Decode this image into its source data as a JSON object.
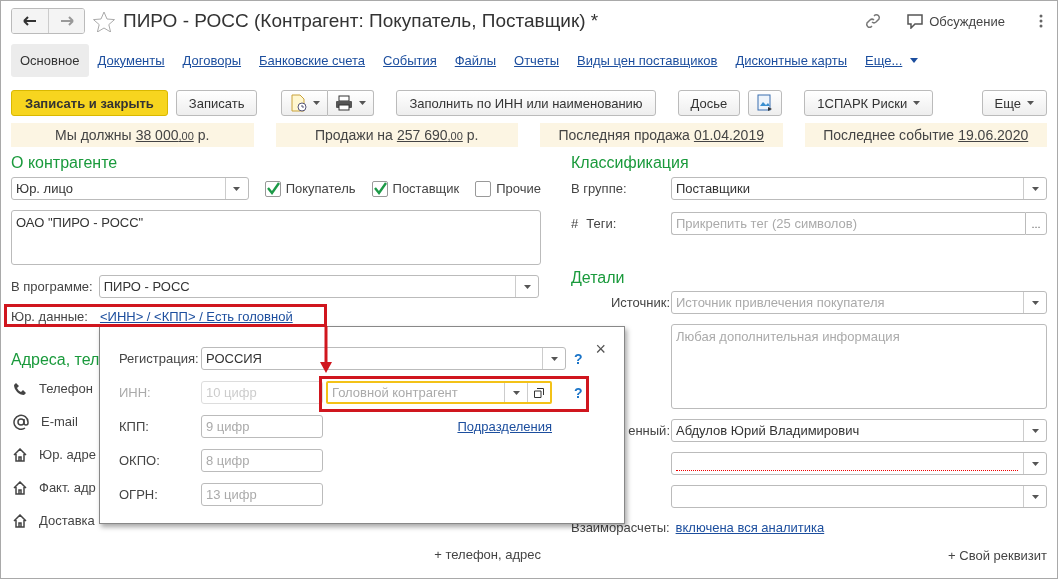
{
  "window": {
    "title": "ПИРО - РОСС (Контрагент: Покупатель, Поставщик) *",
    "discussion": "Обсуждение"
  },
  "tabs": [
    {
      "label": "Основное",
      "selected": true
    },
    {
      "label": "Документы",
      "selected": false
    },
    {
      "label": "Договоры",
      "selected": false
    },
    {
      "label": "Банковские счета",
      "selected": false
    },
    {
      "label": "События",
      "selected": false
    },
    {
      "label": "Файлы",
      "selected": false
    },
    {
      "label": "Отчеты",
      "selected": false
    },
    {
      "label": "Виды цен поставщиков",
      "selected": false
    },
    {
      "label": "Дисконтные карты",
      "selected": false
    },
    {
      "label": "Еще...",
      "selected": false,
      "kind": "menu"
    }
  ],
  "toolbar": [
    {
      "kind": "primary",
      "label": "Записать и закрыть"
    },
    {
      "kind": "button",
      "label": "Записать"
    },
    {
      "kind": "icon_split"
    },
    {
      "kind": "button",
      "label": "Заполнить по ИНН или наименованию"
    },
    {
      "kind": "button",
      "label": "Досье"
    },
    {
      "kind": "icon"
    },
    {
      "kind": "menu",
      "label": "1СПАРК Риски"
    },
    {
      "kind": "menu_right",
      "label": "Еще"
    }
  ],
  "summary": [
    {
      "label": "Мы должны",
      "amount": "38 000",
      "cents": ",00",
      "currency": "р."
    },
    {
      "label": "Продажи на",
      "amount": "257 690",
      "cents": ",00",
      "currency": "р."
    },
    {
      "label": "Последняя продажа",
      "amount": "01.04.2019"
    },
    {
      "label": "Последнее событие",
      "amount": "19.06.2020"
    }
  ],
  "counterparty": {
    "heading": "О контрагенте",
    "type": "Юр. лицо",
    "roles": [
      {
        "label": "Покупатель",
        "checked": true
      },
      {
        "label": "Поставщик",
        "checked": true
      },
      {
        "label": "Прочие",
        "checked": false
      }
    ],
    "full_name": "ОАО \"ПИРО - РОСС\"",
    "in_program_label": "В программе:",
    "in_program": "ПИРО - РОСС",
    "legal_label": "Юр. данные:",
    "legal_link": "<ИНН> / <КПП> / Есть головной"
  },
  "contacts": {
    "heading": "Адреса, тел",
    "items": [
      {
        "kind": "phone",
        "label": "Телефон"
      },
      {
        "kind": "email",
        "label": "E-mail"
      },
      {
        "kind": "address",
        "label": "Юр. адре"
      },
      {
        "kind": "address",
        "label": "Факт. адр"
      },
      {
        "kind": "address",
        "label": "Доставка"
      }
    ],
    "add_link": "+ телефон, адрес"
  },
  "classification": {
    "heading": "Классификация",
    "group_label": "В группе:",
    "group": "Поставщики",
    "tags_mark": "#",
    "tags_label": "Теги:",
    "tags_placeholder": "Прикрепить тег (25 символов)",
    "tags_button": "..."
  },
  "details": {
    "heading": "Детали",
    "fields": [
      {
        "kind": "combo",
        "label": "Источник:",
        "placeholder": "Источник привлечения покупателя"
      },
      {
        "kind": "memo",
        "placeholder": "Любая дополнительная информация"
      },
      {
        "kind": "combo",
        "label": "енный:",
        "value": "Абдулов Юрий Владимирович"
      },
      {
        "kind": "combo",
        "required": true
      },
      {
        "kind": "combo",
        "required": false
      },
      {
        "kind": "link",
        "label": "Взаиморасчеты:",
        "value": "включена вся аналитика"
      }
    ],
    "add_link": "+ Свой реквизит"
  },
  "popup": {
    "close": "×",
    "registration_label": "Регистрация:",
    "registration": "РОССИЯ",
    "registration_help": "?",
    "fields": [
      {
        "label": "ИНН:",
        "placeholder": "10 цифр",
        "disabled": true
      },
      {
        "label": "КПП:",
        "placeholder": "9 цифр",
        "disabled": false
      },
      {
        "label": "ОКПО:",
        "placeholder": "8 цифр",
        "disabled": false
      },
      {
        "label": "ОГРН:",
        "placeholder": "13 цифр",
        "disabled": false
      }
    ],
    "head": {
      "placeholder": "Головной контрагент",
      "focused": true,
      "help": "?"
    },
    "subdivisions_link": "Подразделения"
  }
}
